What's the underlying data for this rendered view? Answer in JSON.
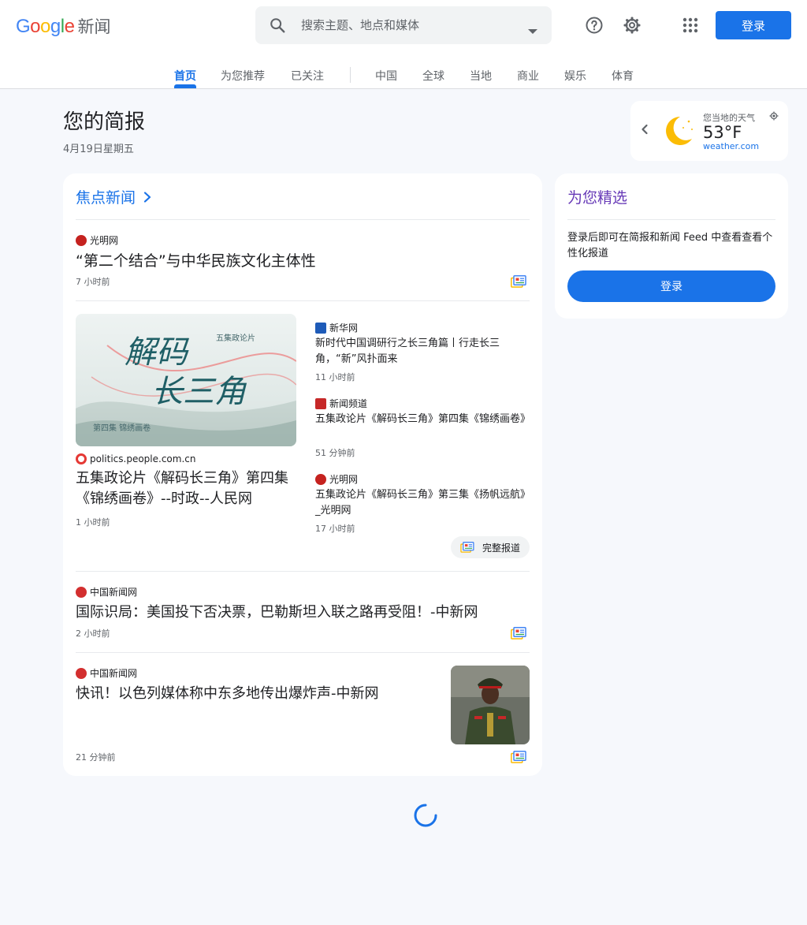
{
  "header": {
    "logo_letters": [
      {
        "char": "G",
        "color": "#4285f4"
      },
      {
        "char": "o",
        "color": "#ea4335"
      },
      {
        "char": "o",
        "color": "#fbbc05"
      },
      {
        "char": "g",
        "color": "#4285f4"
      },
      {
        "char": "l",
        "color": "#34a853"
      },
      {
        "char": "e",
        "color": "#ea4335"
      }
    ],
    "product_name": "新闻",
    "search_placeholder": "搜索主题、地点和媒体",
    "login_label": "登录"
  },
  "nav": {
    "tabs": [
      {
        "label": "首页",
        "active": true
      },
      {
        "label": "为您推荐"
      },
      {
        "label": "已关注"
      },
      {
        "label": "中国"
      },
      {
        "label": "全球"
      },
      {
        "label": "当地"
      },
      {
        "label": "商业"
      },
      {
        "label": "娱乐"
      },
      {
        "label": "体育"
      }
    ]
  },
  "briefing": {
    "title": "您的简报",
    "date": "4月19日星期五"
  },
  "weather": {
    "label": "您当地的天气",
    "temperature": "53°F",
    "source": "weather.com"
  },
  "top_stories": {
    "title": "焦点新闻",
    "story1": {
      "source": "光明网",
      "headline": "“第二个结合”与中华民族文化主体性",
      "time": "7 小时前"
    },
    "cluster": {
      "main": {
        "source": "politics.people.com.cn",
        "headline": "五集政论片《解码长三角》第四集《锦绣画卷》--时政--人民网",
        "time": "1 小时前"
      },
      "image_text": {
        "line1": "解码",
        "line2": "长三角",
        "subtitle": "五集政论片",
        "caption": "第四集 锦绣画卷"
      },
      "related": [
        {
          "source": "新华网",
          "headline": "新时代中国调研行之长三角篇丨行走长三角，“新”风扑面来",
          "time": "11 小时前"
        },
        {
          "source": "新闻频道",
          "headline": "五集政论片《解码长三角》第四集《锦绣画卷》",
          "time": "51 分钟前"
        },
        {
          "source": "光明网",
          "headline": "五集政论片《解码长三角》第三集《扬帆远航》_光明网",
          "time": "17 小时前"
        }
      ],
      "full_coverage": "完整报道"
    },
    "story3": {
      "source": "中国新闻网",
      "headline": "国际识局：美国投下否决票，巴勒斯坦入联之路再受阻！-中新网",
      "time": "2 小时前"
    },
    "story4": {
      "source": "中国新闻网",
      "headline": "快讯！以色列媒体称中东多地传出爆炸声-中新网",
      "time": "21 分钟前"
    }
  },
  "picks": {
    "title": "为您精选",
    "text": "登录后即可在简报和新闻 Feed 中查看查看个性化报道",
    "button": "登录"
  },
  "colors": {
    "accent": "#1a73e8",
    "picks_title": "#673ab7",
    "background": "#f6f8fc"
  },
  "icons": [
    "search-icon",
    "help-icon",
    "settings-icon",
    "apps-icon",
    "chevron-right-icon",
    "chevron-left-icon",
    "moon-icon",
    "location-icon",
    "full-coverage-icon",
    "loading-spinner"
  ]
}
